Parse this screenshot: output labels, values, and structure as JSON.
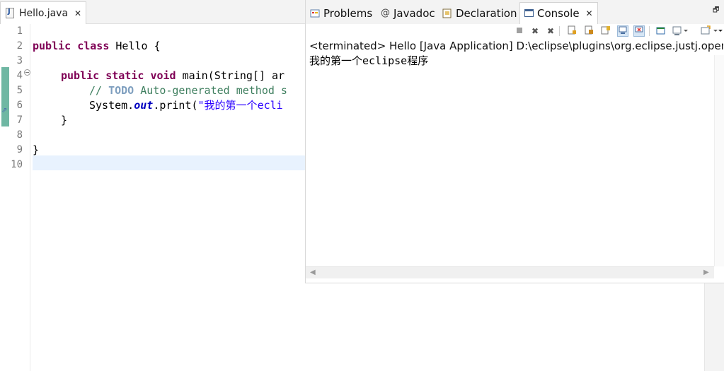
{
  "editor": {
    "tab": {
      "filename": "Hello.java",
      "close_glyph": "✕"
    },
    "line_numbers": [
      "1",
      "2",
      "3",
      "4",
      "5",
      "6",
      "7",
      "8",
      "9",
      "10"
    ],
    "code": {
      "line2": {
        "kw1": "public",
        "kw2": "class",
        "rest": " Hello {"
      },
      "line4": {
        "kw1": "public",
        "kw2": "static",
        "kw3": "void",
        "rest": " main(String[] ar"
      },
      "line5": {
        "comment_start": "// ",
        "todo": "TODO",
        "comment_rest": " Auto-generated method s"
      },
      "line6": {
        "obj": "System.",
        "field": "out",
        "call": ".print(",
        "string": "\"我的第一个ecli"
      },
      "line7": "}",
      "line9": "}"
    }
  },
  "console_view": {
    "tabs": [
      {
        "label": "Problems",
        "icon": "problems-icon"
      },
      {
        "label": "Javadoc",
        "icon": "javadoc-icon"
      },
      {
        "label": "Declaration",
        "icon": "declaration-icon"
      },
      {
        "label": "Console",
        "icon": "console-icon",
        "active": true
      }
    ],
    "close_glyph": "✕",
    "maximize_glyph": "🗗",
    "toolbar": [
      "terminate-icon",
      "remove-launch-icon",
      "remove-all-terminated-icon",
      "scroll-lock-icon",
      "word-wrap-icon",
      "show-console-on-stdout-icon",
      "show-console-on-stderr-icon",
      "pin-console-icon",
      "display-selected-console-icon",
      "open-console-icon"
    ],
    "status": "<terminated> Hello [Java Application] D:\\eclipse\\plugins\\org.eclipse.justj.openjd",
    "output": "我的第一个eclipse程序"
  },
  "colors": {
    "keyword": "#7f0055",
    "comment": "#3f7f5f",
    "string": "#2a00ff",
    "field": "#0000c0",
    "change_bar": "#6fb7a3",
    "current_line": "#e8f2fe"
  }
}
